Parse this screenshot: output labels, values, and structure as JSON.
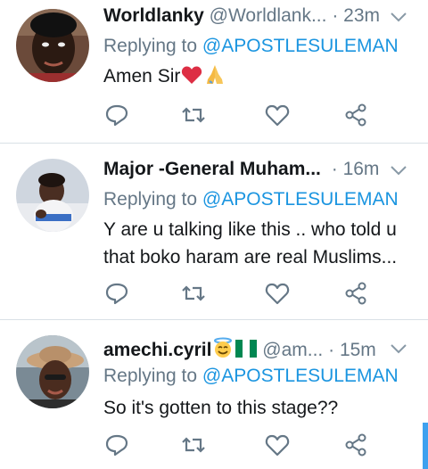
{
  "tweets": [
    {
      "name": "Worldlanky",
      "handle": "@Worldlank...",
      "separator": "·",
      "time": "23m",
      "replying_prefix": "Replying to ",
      "replying_user": "@APOSTLESULEMAN",
      "text_lines": [
        "Amen Sir"
      ],
      "emoji": [
        "red-heart",
        "folded-hands"
      ]
    },
    {
      "name": "Major -General Muham...",
      "handle": "",
      "separator": "·",
      "time": "16m",
      "replying_prefix": "Replying to ",
      "replying_user": "@APOSTLESULEMAN",
      "text_lines": [
        "Y are u talking like this .. who told u",
        "that boko haram are real Muslims..."
      ]
    },
    {
      "name": "amechi.cyril",
      "handle": "@am...",
      "separator": "·",
      "time": "15m",
      "replying_prefix": "Replying to ",
      "replying_user": "@APOSTLESULEMAN",
      "text_lines": [
        "So it's gotten to this stage??"
      ],
      "emoji": [
        "smiling-face-with-halo",
        "nigeria-flag"
      ]
    }
  ],
  "actions": [
    "reply-icon",
    "retweet-icon",
    "like-icon",
    "share-icon"
  ],
  "colors": {
    "name": "#14171a",
    "muted": "#657786",
    "link": "#1b95e0",
    "divider": "#d9e0e6",
    "scrollbar": "#3ea1ef"
  }
}
